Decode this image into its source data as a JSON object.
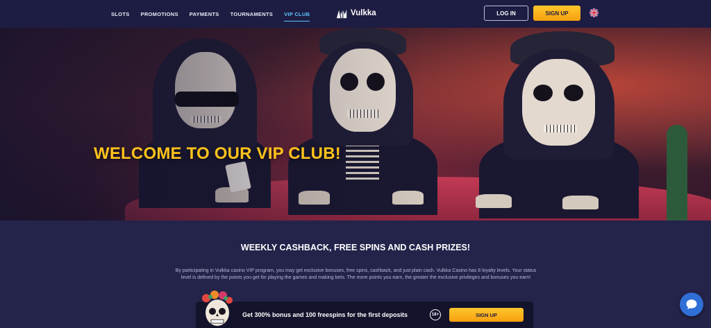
{
  "header": {
    "nav": [
      {
        "label": "SLOTS",
        "active": false
      },
      {
        "label": "PROMOTIONS",
        "active": false
      },
      {
        "label": "PAYMENTS",
        "active": false
      },
      {
        "label": "TOURNAMENTS",
        "active": false
      },
      {
        "label": "VIP CLUB",
        "active": true
      }
    ],
    "logo_text": "Vulkka",
    "login_label": "LOG IN",
    "signup_label": "SIGN UP",
    "language_icon": "uk-flag-icon"
  },
  "hero": {
    "title": "WELCOME TO OUR VIP CLUB!"
  },
  "content": {
    "title": "WEEKLY CASHBACK, FREE SPINS AND CASH PRIZES!",
    "text": "By participating in Vulkka casino VIP program, you may get exclusive bonuses, free spins, cashback, and just plain cash. Vulkka Casino has 8 loyalty levels. Your status level is defined by the points you get for playing the games and making bets. The more points you earn, the greater the exclusive privileges and bonuses you earn!"
  },
  "promo_bar": {
    "text": "Get 300% bonus and 100 freespins for the first deposits",
    "age_badge": "18+",
    "signup_label": "SIGN UP"
  },
  "colors": {
    "accent_yellow": "#ffc21c",
    "active_link": "#5fc6ff",
    "header_bg": "#1d1c42",
    "page_bg": "#24234a"
  }
}
